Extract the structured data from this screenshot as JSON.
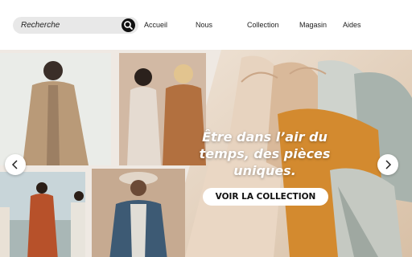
{
  "search": {
    "placeholder": "Recherche",
    "icon": "search-icon"
  },
  "nav": [
    {
      "label": "Accueil"
    },
    {
      "label": "Nous"
    },
    {
      "label": "Collection"
    },
    {
      "label": "Magasin"
    },
    {
      "label": "Aides"
    }
  ],
  "hero": {
    "headline_lines": [
      "Être dans l’air du",
      "temps, des pièces",
      "uniques."
    ],
    "cta_label": "VOIR LA COLLECTION",
    "prev_icon": "chevron-left-icon",
    "next_icon": "chevron-right-icon"
  },
  "colors": {
    "header_bg": "#ffffff",
    "search_bg": "#e8e8e8",
    "cta_bg": "#ffffff",
    "text": "#222222"
  }
}
